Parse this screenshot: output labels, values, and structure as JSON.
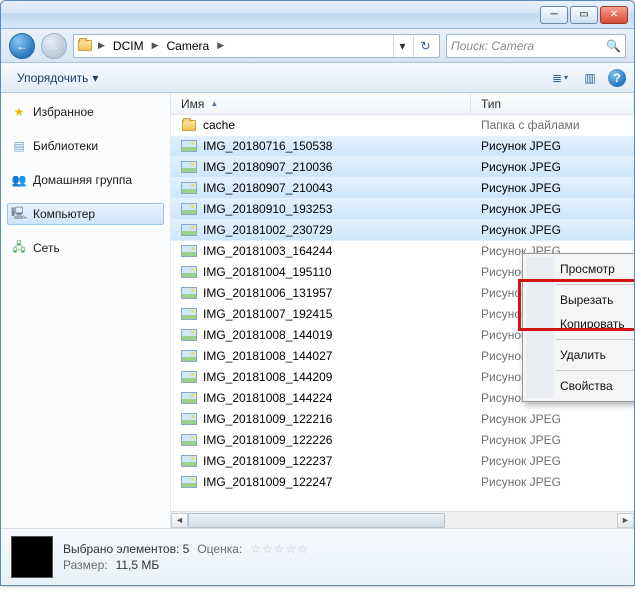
{
  "titlebar": {
    "minimize": "─",
    "maximize": "▭",
    "close": "✕"
  },
  "nav": {
    "back": "←",
    "forward": "→",
    "refresh": "↻",
    "dropdown": "▾"
  },
  "breadcrumb": {
    "seg1": "DCIM",
    "seg2": "Camera"
  },
  "search": {
    "placeholder": "Поиск: Camera",
    "icon": "🔍"
  },
  "toolbar": {
    "organize": "Упорядочить",
    "organize_chevron": "▾",
    "views_icon": "≣",
    "preview_icon": "▥",
    "help": "?"
  },
  "sidebar": {
    "favorites": "Избранное",
    "libraries": "Библиотеки",
    "homegroup": "Домашняя группа",
    "computer": "Компьютер",
    "network": "Сеть"
  },
  "columns": {
    "name": "Имя",
    "type": "Тип",
    "sort": "▲"
  },
  "type_folder": "Папка с файлами",
  "type_jpeg": "Рисунок JPEG",
  "files": [
    {
      "name": "cache",
      "type_key": "folder",
      "icon": "folder",
      "selected": false
    },
    {
      "name": "IMG_20180716_150538",
      "type_key": "jpeg",
      "icon": "image",
      "selected": true
    },
    {
      "name": "IMG_20180907_210036",
      "type_key": "jpeg",
      "icon": "image",
      "selected": true
    },
    {
      "name": "IMG_20180907_210043",
      "type_key": "jpeg",
      "icon": "image",
      "selected": true
    },
    {
      "name": "IMG_20180910_193253",
      "type_key": "jpeg",
      "icon": "image",
      "selected": true
    },
    {
      "name": "IMG_20181002_230729",
      "type_key": "jpeg",
      "icon": "image",
      "selected": true
    },
    {
      "name": "IMG_20181003_164244",
      "type_key": "jpeg",
      "icon": "image",
      "selected": false
    },
    {
      "name": "IMG_20181004_195110",
      "type_key": "jpeg",
      "icon": "image",
      "selected": false
    },
    {
      "name": "IMG_20181006_131957",
      "type_key": "jpeg",
      "icon": "image",
      "selected": false
    },
    {
      "name": "IMG_20181007_192415",
      "type_key": "jpeg",
      "icon": "image",
      "selected": false
    },
    {
      "name": "IMG_20181008_144019",
      "type_key": "jpeg",
      "icon": "image",
      "selected": false
    },
    {
      "name": "IMG_20181008_144027",
      "type_key": "jpeg",
      "icon": "image",
      "selected": false
    },
    {
      "name": "IMG_20181008_144209",
      "type_key": "jpeg",
      "icon": "image",
      "selected": false
    },
    {
      "name": "IMG_20181008_144224",
      "type_key": "jpeg",
      "icon": "image",
      "selected": false
    },
    {
      "name": "IMG_20181009_122216",
      "type_key": "jpeg",
      "icon": "image",
      "selected": false
    },
    {
      "name": "IMG_20181009_122226",
      "type_key": "jpeg",
      "icon": "image",
      "selected": false
    },
    {
      "name": "IMG_20181009_122237",
      "type_key": "jpeg",
      "icon": "image",
      "selected": false
    },
    {
      "name": "IMG_20181009_122247",
      "type_key": "jpeg",
      "icon": "image",
      "selected": false
    }
  ],
  "context_menu": {
    "view": "Просмотр",
    "cut": "Вырезать",
    "copy": "Копировать",
    "delete": "Удалить",
    "properties": "Свойства"
  },
  "details": {
    "selected_label": "Выбрано элементов: 5",
    "rating_label": "Оценка:",
    "stars": "☆☆☆☆☆",
    "size_label": "Размер:",
    "size_value": "11,5 МБ"
  }
}
